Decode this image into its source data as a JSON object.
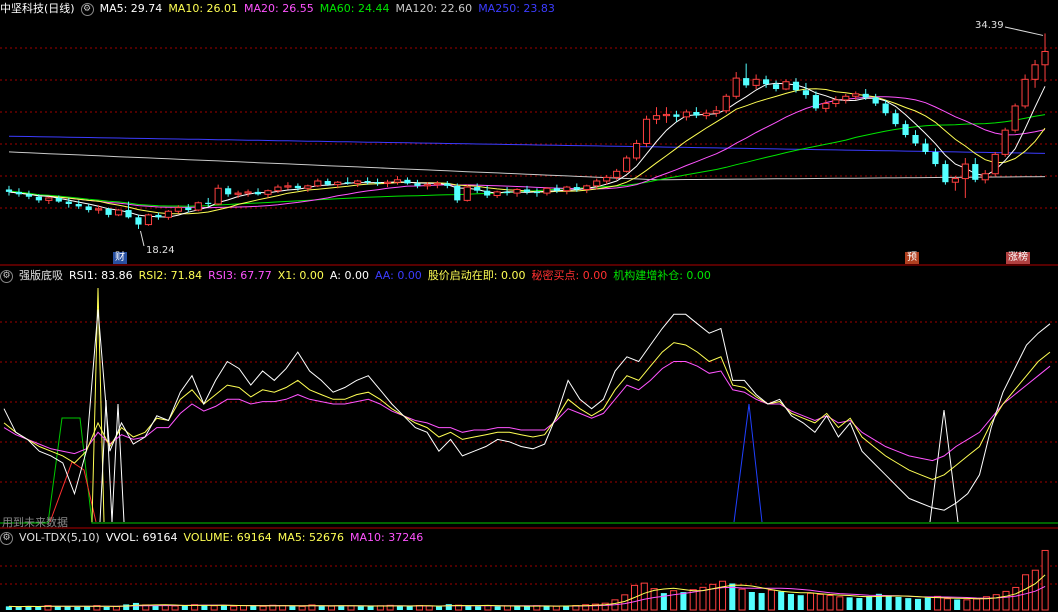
{
  "colors": {
    "up": "#ff4040",
    "down": "#54ffff",
    "ma5": "#ffffff",
    "ma10": "#ffff54",
    "ma20": "#ff54ff",
    "ma60": "#00e600",
    "ma120": "#c8c8c8",
    "ma250": "#3c3cff",
    "rsi1": "#ffffff",
    "rsi2": "#ffff54",
    "rsi3": "#ff54ff",
    "grid": "#a00000",
    "vol_ma5": "#ffff54",
    "vol_ma10": "#ff54ff"
  },
  "main": {
    "title": "中坚科技(日线)",
    "icon": "settings-icon",
    "ma": [
      {
        "label": "MA5: 29.74",
        "color": "#ffffff"
      },
      {
        "label": "MA10: 26.01",
        "color": "#ffff54"
      },
      {
        "label": "MA20: 26.55",
        "color": "#ff54ff"
      },
      {
        "label": "MA60: 24.44",
        "color": "#00e600"
      },
      {
        "label": "MA120: 22.60",
        "color": "#c8c8c8"
      },
      {
        "label": "MA250: 23.83",
        "color": "#3c3cff"
      }
    ],
    "high_label": "34.39",
    "low_label": "18.24",
    "tags": [
      {
        "text": "财",
        "bg": "#2850a0"
      },
      {
        "text": "预",
        "bg": "#b04020"
      },
      {
        "text": "涨榜",
        "bg": "#b04040"
      }
    ]
  },
  "rsi": {
    "title": "强版底吸",
    "icon": "settings-icon",
    "items": [
      {
        "label": "RSI1: 83.86",
        "color": "#ffffff"
      },
      {
        "label": "RSI2: 71.84",
        "color": "#ffff54"
      },
      {
        "label": "RSI3: 67.77",
        "color": "#ff54ff"
      },
      {
        "label": "X1: 0.00",
        "color": "#ffff54"
      },
      {
        "label": "A: 0.00",
        "color": "#ffffff"
      },
      {
        "label": "AA: 0.00",
        "color": "#3c3cff"
      },
      {
        "label": "股价启动在即: 0.00",
        "color": "#ffff54"
      },
      {
        "label": "秘密买点: 0.00",
        "color": "#ff3030"
      },
      {
        "label": "机构建增补仓: 0.00",
        "color": "#00e600"
      }
    ],
    "watermark": "用到未来数据"
  },
  "volume": {
    "title": "VOL-TDX(5,10)",
    "icon": "settings-icon",
    "items": [
      {
        "label": "VVOL: 69164",
        "color": "#ffffff"
      },
      {
        "label": "VOLUME: 69164",
        "color": "#ffff54"
      },
      {
        "label": "MA5: 52676",
        "color": "#ffff54"
      },
      {
        "label": "MA10: 37246",
        "color": "#ff54ff"
      }
    ]
  },
  "chart_data": [
    {
      "type": "candlestick",
      "title": "中坚科技(日线)",
      "ylim": [
        16.5,
        35.5
      ],
      "ma_flat": {
        "ma120": [
          {
            "i": 0,
            "v": 24.6
          },
          {
            "i": 65,
            "v": 22.3
          },
          {
            "i": 110,
            "v": 22.6
          }
        ],
        "ma250": [
          {
            "i": 0,
            "v": 25.9
          },
          {
            "i": 110,
            "v": 24.4
          }
        ]
      },
      "candles": [
        [
          21.5,
          21.8,
          21.0,
          21.3
        ],
        [
          21.3,
          21.6,
          20.9,
          21.1
        ],
        [
          21.1,
          21.4,
          20.7,
          20.9
        ],
        [
          20.9,
          21.1,
          20.4,
          20.6
        ],
        [
          20.6,
          20.9,
          20.3,
          20.8
        ],
        [
          20.8,
          21.0,
          20.4,
          20.5
        ],
        [
          20.5,
          20.8,
          20.0,
          20.3
        ],
        [
          20.3,
          20.6,
          19.9,
          20.1
        ],
        [
          20.1,
          20.3,
          19.6,
          19.8
        ],
        [
          19.8,
          20.2,
          19.5,
          19.9
        ],
        [
          19.9,
          20.0,
          19.2,
          19.4
        ],
        [
          19.4,
          19.9,
          19.3,
          19.8
        ],
        [
          19.8,
          20.5,
          19.1,
          19.2
        ],
        [
          19.2,
          19.4,
          18.24,
          18.6
        ],
        [
          18.6,
          19.5,
          18.5,
          19.4
        ],
        [
          19.4,
          19.6,
          19.0,
          19.2
        ],
        [
          19.2,
          19.8,
          19.0,
          19.7
        ],
        [
          19.7,
          20.2,
          19.5,
          20.0
        ],
        [
          20.0,
          20.3,
          19.6,
          19.8
        ],
        [
          19.8,
          20.5,
          19.7,
          20.4
        ],
        [
          20.4,
          20.8,
          20.1,
          20.3
        ],
        [
          20.3,
          21.9,
          20.2,
          21.6
        ],
        [
          21.6,
          21.8,
          20.9,
          21.1
        ],
        [
          21.1,
          21.4,
          20.8,
          21.2
        ],
        [
          21.2,
          21.5,
          20.9,
          21.3
        ],
        [
          21.3,
          21.6,
          21.0,
          21.1
        ],
        [
          21.1,
          21.5,
          20.8,
          21.4
        ],
        [
          21.4,
          21.9,
          21.2,
          21.7
        ],
        [
          21.7,
          22.1,
          21.5,
          21.8
        ],
        [
          21.8,
          22.0,
          21.4,
          21.6
        ],
        [
          21.6,
          21.9,
          21.3,
          21.8
        ],
        [
          21.8,
          22.4,
          21.7,
          22.2
        ],
        [
          22.2,
          22.4,
          21.8,
          21.9
        ],
        [
          21.9,
          22.2,
          21.6,
          22.1
        ],
        [
          22.1,
          22.5,
          21.9,
          22.0
        ],
        [
          22.0,
          22.3,
          21.7,
          22.2
        ],
        [
          22.2,
          22.5,
          21.9,
          22.1
        ],
        [
          22.1,
          22.4,
          21.8,
          22.0
        ],
        [
          22.0,
          22.3,
          21.7,
          22.1
        ],
        [
          22.1,
          22.6,
          21.9,
          22.3
        ],
        [
          22.3,
          22.5,
          21.9,
          22.0
        ],
        [
          22.0,
          22.3,
          21.6,
          21.8
        ],
        [
          21.8,
          22.1,
          21.5,
          21.9
        ],
        [
          21.9,
          22.2,
          21.6,
          22.0
        ],
        [
          22.0,
          22.2,
          21.6,
          21.8
        ],
        [
          21.8,
          22.0,
          20.4,
          20.6
        ],
        [
          20.6,
          21.9,
          20.5,
          21.7
        ],
        [
          21.7,
          22.0,
          21.2,
          21.4
        ],
        [
          21.4,
          21.8,
          20.8,
          21.0
        ],
        [
          21.0,
          21.4,
          20.8,
          21.3
        ],
        [
          21.3,
          21.7,
          21.0,
          21.2
        ],
        [
          21.2,
          21.6,
          20.9,
          21.5
        ],
        [
          21.5,
          21.8,
          21.1,
          21.3
        ],
        [
          21.3,
          21.6,
          20.9,
          21.2
        ],
        [
          21.2,
          21.7,
          21.0,
          21.6
        ],
        [
          21.6,
          21.9,
          21.2,
          21.4
        ],
        [
          21.4,
          21.8,
          21.1,
          21.7
        ],
        [
          21.7,
          22.0,
          21.3,
          21.5
        ],
        [
          21.5,
          21.9,
          21.2,
          21.8
        ],
        [
          21.8,
          22.4,
          21.5,
          22.2
        ],
        [
          22.2,
          22.7,
          21.9,
          22.5
        ],
        [
          22.5,
          23.2,
          22.3,
          23.0
        ],
        [
          23.0,
          24.3,
          22.9,
          24.1
        ],
        [
          24.1,
          25.6,
          23.9,
          25.3
        ],
        [
          25.3,
          27.6,
          25.0,
          27.3
        ],
        [
          27.3,
          28.3,
          26.9,
          27.6
        ],
        [
          27.6,
          28.3,
          27.0,
          27.7
        ],
        [
          27.7,
          28.0,
          27.1,
          27.5
        ],
        [
          27.5,
          28.1,
          27.2,
          27.9
        ],
        [
          27.9,
          28.3,
          27.4,
          27.6
        ],
        [
          27.6,
          28.1,
          27.3,
          27.8
        ],
        [
          27.8,
          28.4,
          27.5,
          28.0
        ],
        [
          28.0,
          29.4,
          27.8,
          29.2
        ],
        [
          29.2,
          31.2,
          29.0,
          30.7
        ],
        [
          30.7,
          31.9,
          29.9,
          30.1
        ],
        [
          30.1,
          31.0,
          29.8,
          30.6
        ],
        [
          30.6,
          30.9,
          29.9,
          30.2
        ],
        [
          30.2,
          30.5,
          29.6,
          29.8
        ],
        [
          29.8,
          30.6,
          29.7,
          30.4
        ],
        [
          30.4,
          30.7,
          29.5,
          29.7
        ],
        [
          29.7,
          30.3,
          29.0,
          29.3
        ],
        [
          29.3,
          29.6,
          28.0,
          28.2
        ],
        [
          28.2,
          28.9,
          27.9,
          28.6
        ],
        [
          28.6,
          29.2,
          28.3,
          28.9
        ],
        [
          28.9,
          29.4,
          28.6,
          29.2
        ],
        [
          29.2,
          29.6,
          28.9,
          29.4
        ],
        [
          29.4,
          29.8,
          28.9,
          29.1
        ],
        [
          29.1,
          29.4,
          28.4,
          28.6
        ],
        [
          28.6,
          28.9,
          27.6,
          27.8
        ],
        [
          27.8,
          28.1,
          26.7,
          26.9
        ],
        [
          26.9,
          27.2,
          25.8,
          26.0
        ],
        [
          26.0,
          26.4,
          25.1,
          25.3
        ],
        [
          25.3,
          25.7,
          24.4,
          24.6
        ],
        [
          24.6,
          24.9,
          23.4,
          23.6
        ],
        [
          23.6,
          23.9,
          21.9,
          22.1
        ],
        [
          22.1,
          22.6,
          21.4,
          22.4
        ],
        [
          22.4,
          24.1,
          20.8,
          23.6
        ],
        [
          23.6,
          24.1,
          22.1,
          22.3
        ],
        [
          22.3,
          23.1,
          22.0,
          22.8
        ],
        [
          22.8,
          24.6,
          22.6,
          24.4
        ],
        [
          24.4,
          26.6,
          24.2,
          26.4
        ],
        [
          26.4,
          28.6,
          26.2,
          28.4
        ],
        [
          28.4,
          31.0,
          28.2,
          30.6
        ],
        [
          30.6,
          32.2,
          29.9,
          31.8
        ],
        [
          31.8,
          34.39,
          30.4,
          32.9
        ]
      ]
    },
    {
      "type": "line",
      "title": "强版底吸",
      "ylim": [
        0,
        100
      ],
      "series": [
        {
          "name": "RSI1",
          "values": [
            48,
            38,
            35,
            30,
            28,
            25,
            12,
            30,
            90,
            30,
            42,
            33,
            36,
            45,
            43,
            55,
            62,
            50,
            60,
            68,
            65,
            58,
            64,
            60,
            65,
            72,
            64,
            60,
            55,
            57,
            60,
            62,
            56,
            50,
            45,
            40,
            38,
            30,
            35,
            28,
            30,
            32,
            35,
            34,
            32,
            31,
            33,
            45,
            60,
            52,
            48,
            52,
            64,
            70,
            68,
            75,
            82,
            88,
            88,
            84,
            80,
            82,
            60,
            60,
            54,
            50,
            52,
            45,
            42,
            38,
            45,
            36,
            42,
            30,
            25,
            20,
            15,
            10,
            8,
            6,
            5,
            8,
            12,
            20,
            40,
            55,
            65,
            75,
            80,
            84
          ]
        },
        {
          "name": "RSI2",
          "values": [
            42,
            38,
            35,
            32,
            30,
            28,
            25,
            30,
            42,
            32,
            40,
            36,
            38,
            44,
            43,
            52,
            56,
            50,
            54,
            58,
            57,
            53,
            56,
            55,
            57,
            60,
            56,
            54,
            52,
            52,
            54,
            55,
            52,
            48,
            45,
            42,
            40,
            36,
            38,
            35,
            36,
            37,
            38,
            38,
            37,
            36,
            37,
            44,
            52,
            48,
            45,
            48,
            56,
            62,
            60,
            66,
            72,
            76,
            75,
            72,
            68,
            70,
            58,
            57,
            53,
            50,
            51,
            46,
            44,
            42,
            46,
            40,
            44,
            36,
            32,
            28,
            25,
            22,
            20,
            18,
            20,
            24,
            28,
            32,
            42,
            50,
            56,
            62,
            68,
            72
          ]
        },
        {
          "name": "RSI3",
          "values": [
            40,
            37,
            35,
            33,
            31,
            30,
            29,
            31,
            38,
            33,
            37,
            35,
            36,
            40,
            40,
            46,
            50,
            47,
            49,
            52,
            52,
            50,
            51,
            51,
            52,
            54,
            52,
            51,
            50,
            50,
            51,
            52,
            50,
            47,
            45,
            43,
            42,
            40,
            40,
            38,
            39,
            39,
            40,
            40,
            39,
            39,
            39,
            43,
            48,
            46,
            44,
            46,
            52,
            58,
            56,
            60,
            65,
            68,
            68,
            66,
            63,
            64,
            56,
            55,
            52,
            50,
            50,
            47,
            45,
            43,
            45,
            42,
            43,
            38,
            35,
            32,
            30,
            28,
            27,
            26,
            28,
            32,
            35,
            38,
            44,
            50,
            54,
            58,
            62,
            66
          ]
        }
      ]
    },
    {
      "type": "bar",
      "title": "VOL-TDX(5,10)",
      "ylim": [
        0,
        72000
      ],
      "values": [
        4200,
        3800,
        4500,
        3900,
        5200,
        4100,
        4600,
        3700,
        4300,
        5100,
        3600,
        4000,
        6500,
        8200,
        5900,
        4800,
        5300,
        4700,
        5600,
        6200,
        5200,
        4900,
        5800,
        4400,
        5100,
        4700,
        4300,
        5500,
        5000,
        4600,
        4200,
        5900,
        4800,
        4500,
        5300,
        4700,
        4400,
        4100,
        4900,
        5400,
        4800,
        4300,
        5200,
        4600,
        4000,
        6800,
        5600,
        4700,
        4400,
        5100,
        4300,
        4800,
        4500,
        4200,
        5000,
        4600,
        4400,
        4900,
        5200,
        6100,
        6800,
        7900,
        11800,
        17600,
        28600,
        31200,
        24800,
        19600,
        22400,
        20800,
        23600,
        26300,
        29800,
        33400,
        30800,
        24200,
        20900,
        19700,
        23100,
        21400,
        18600,
        17200,
        19400,
        18100,
        16800,
        15300,
        14700,
        13900,
        16200,
        18800,
        16900,
        15200,
        13800,
        12900,
        14300,
        15800,
        13100,
        12200,
        11800,
        12900,
        15400,
        17800,
        21600,
        26200,
        40900,
        46200,
        69164
      ],
      "series": [
        {
          "name": "MA5",
          "values": []
        },
        {
          "name": "MA10",
          "values": []
        }
      ]
    }
  ]
}
